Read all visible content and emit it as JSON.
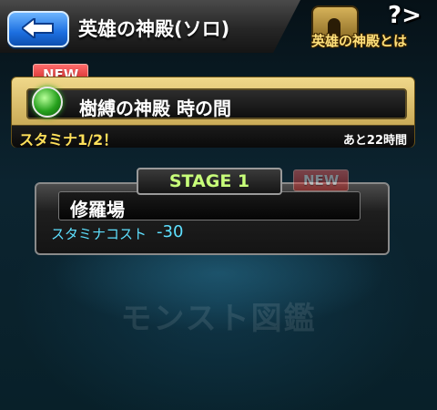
{
  "header": {
    "title": "英雄の神殿(ソロ)",
    "back_icon": "arrow-left-icon",
    "about_label": "英雄の神殿とは",
    "about_mark": "?>"
  },
  "dungeon": {
    "new_label": "NEW",
    "name": "樹縛の神殿 時の間",
    "element_color": "#2eaa22",
    "stamina_note": "スタミナ1/2！",
    "time_left": "あと22時間"
  },
  "stage": {
    "tab_label": "STAGE 1",
    "new_label": "NEW",
    "name": "修羅場",
    "cost_label": "スタミナコスト",
    "cost_value": "-30"
  },
  "background": {
    "watermark": "モンスト図鑑"
  }
}
